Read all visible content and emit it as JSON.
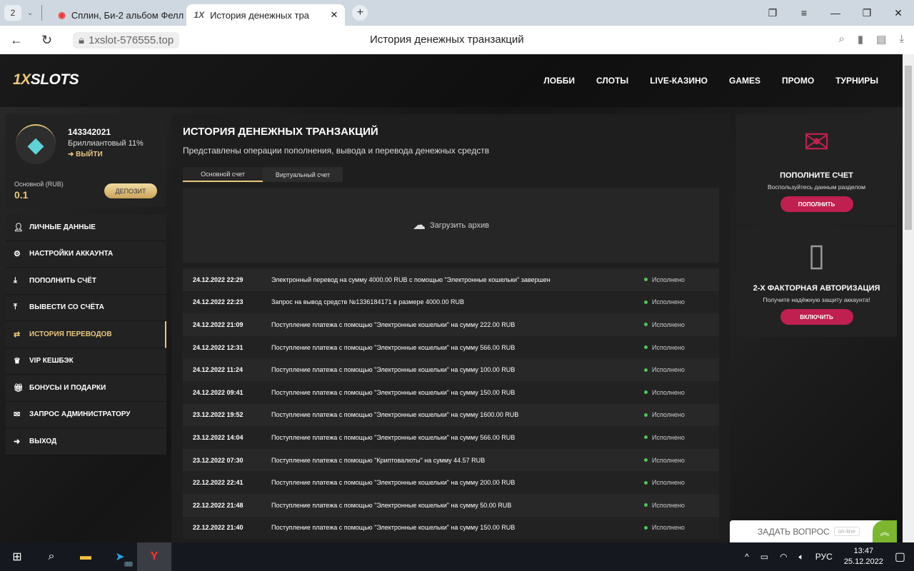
{
  "browser": {
    "tab_count": "2",
    "tabs": [
      {
        "label": "Сплин, Би-2 альбом Фелл"
      },
      {
        "label": "История денежных тра",
        "icon": "1X"
      }
    ],
    "url": "1xslot-576555.top",
    "page_title": "История денежных транзакций"
  },
  "site": {
    "logo": "1XSLOTS",
    "nav": [
      "ЛОББИ",
      "СЛОТЫ",
      "LIVE-КАЗИНО",
      "GAMES",
      "ПРОМО",
      "ТУРНИРЫ"
    ]
  },
  "profile": {
    "user_id": "143342021",
    "level": "Бриллиантовый 11%",
    "level_progress": 11,
    "logout": "ВЫЙТИ",
    "balance_label": "Основной (RUB)",
    "balance": "0.1",
    "deposit": "ДЕПОЗИТ"
  },
  "menu": [
    {
      "label": "ЛИЧНЫЕ ДАННЫЕ",
      "icon": "user-icon"
    },
    {
      "label": "НАСТРОЙКИ АККАУНТА",
      "icon": "gears-icon"
    },
    {
      "label": "ПОПОЛНИТЬ СЧЁТ",
      "icon": "download-icon"
    },
    {
      "label": "ВЫВЕСТИ СО СЧЁТА",
      "icon": "upload-icon"
    },
    {
      "label": "ИСТОРИЯ ПЕРЕВОДОВ",
      "icon": "transfer-icon",
      "active": true
    },
    {
      "label": "VIP КЕШБЭК",
      "icon": "crown-icon"
    },
    {
      "label": "БОНУСЫ И ПОДАРКИ",
      "icon": "gift-icon"
    },
    {
      "label": "ЗАПРОС АДМИНИСТРАТОРУ",
      "icon": "mail-icon"
    },
    {
      "label": "ВЫХОД",
      "icon": "exit-icon"
    }
  ],
  "main": {
    "title": "ИСТОРИЯ ДЕНЕЖНЫХ ТРАНЗАКЦИЙ",
    "subtitle": "Представлены операции пополнения, вывода и перевода денежных средств",
    "tabs": [
      "Основной счет",
      "Виртуальный счет"
    ],
    "archive": "Загрузить архив",
    "transactions": [
      {
        "date": "24.12.2022 22:29",
        "text": "Электронный перевод на сумму 4000.00 RUB с помощью \"Электронные кошельки\" завершен",
        "status": "Исполнено"
      },
      {
        "date": "24.12.2022 22:23",
        "text": "Запрос на вывод средств №1336184171 в размере 4000.00 RUB",
        "status": "Исполнено"
      },
      {
        "date": "24.12.2022 21:09",
        "text": "Поступление платежа с помощью \"Электронные кошельки\" на сумму 222.00 RUB",
        "status": "Исполнено"
      },
      {
        "date": "24.12.2022 12:31",
        "text": "Поступление платежа с помощью \"Электронные кошельки\" на сумму 566.00 RUB",
        "status": "Исполнено"
      },
      {
        "date": "24.12.2022 11:24",
        "text": "Поступление платежа с помощью \"Электронные кошельки\" на сумму 100.00 RUB",
        "status": "Исполнено"
      },
      {
        "date": "24.12.2022 09:41",
        "text": "Поступление платежа с помощью \"Электронные кошельки\" на сумму 150.00 RUB",
        "status": "Исполнено"
      },
      {
        "date": "23.12.2022 19:52",
        "text": "Поступление платежа с помощью \"Электронные кошельки\" на сумму 1600.00 RUB",
        "status": "Исполнено"
      },
      {
        "date": "23.12.2022 14:04",
        "text": "Поступление платежа с помощью \"Электронные кошельки\" на сумму 566.00 RUB",
        "status": "Исполнено"
      },
      {
        "date": "23.12.2022 07:30",
        "text": "Поступление платежа с помощью \"Криптовалюты\" на сумму 44.57 RUB",
        "status": "Исполнено"
      },
      {
        "date": "22.12.2022 22:41",
        "text": "Поступление платежа с помощью \"Электронные кошельки\" на сумму 200.00 RUB",
        "status": "Исполнено"
      },
      {
        "date": "22.12.2022 21:48",
        "text": "Поступление платежа с помощью \"Электронные кошельки\" на сумму 50.00 RUB",
        "status": "Исполнено"
      },
      {
        "date": "22.12.2022 21:40",
        "text": "Поступление платежа с помощью \"Электронные кошельки\" на сумму 150.00 RUB",
        "status": "Исполнено"
      }
    ]
  },
  "promo": [
    {
      "title": "ПОПОЛНИТЕ СЧЕТ",
      "text": "Воспользуйтесь данным разделом",
      "button": "ПОПОЛНИТЬ"
    },
    {
      "title": "2-Х ФАКТОРНАЯ АВТОРИЗАЦИЯ",
      "text": "Получите надёжную защиту аккаунта!",
      "button": "ВКЛЮЧИТЬ"
    }
  ],
  "chat": {
    "label": "ЗАДАТЬ ВОПРОС",
    "status": "on-line"
  },
  "taskbar": {
    "telegram_badge": "62",
    "lang": "РУС",
    "time": "13:47",
    "date": "25.12.2022"
  },
  "colors": {
    "accent": "#e8c77d",
    "promo_button": "#c0204f",
    "status_ok": "#4fc35a"
  }
}
